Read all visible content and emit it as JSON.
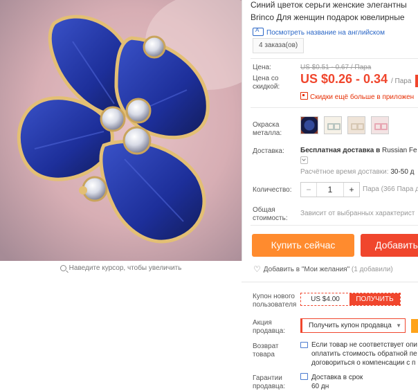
{
  "product": {
    "title_line1": "Синий цветок серьги женские элегантны",
    "title_line2": "Brinco Для женщин подарок ювелирные",
    "translate_link": "Посмотреть название на английском",
    "orders": "4 заказа(ов)"
  },
  "gallery": {
    "zoom_hint": "Наведите курсор, чтобы увеличить"
  },
  "price": {
    "label": "Цена:",
    "original": "US $0.51 - 0.67 / Пара",
    "discount_label": "Цена со скидкой:",
    "sale": "US $0.26 - 0.34",
    "sale_unit": "/ Пара",
    "app_discount": "Скидки ещё больше в приложен"
  },
  "color": {
    "label": "Окраска металла:",
    "swatches": [
      "swatch-blue-flower",
      "swatch-silver",
      "swatch-champagne",
      "swatch-pink"
    ]
  },
  "shipping": {
    "label": "Доставка:",
    "free_prefix": "Бесплатная доставка в",
    "free_dest": "Russian Fe",
    "time_label": "Расчётное время доставки:",
    "time_value": "30-50 д"
  },
  "quantity": {
    "label": "Количество:",
    "minus": "−",
    "value": "1",
    "plus": "+",
    "note": "Пара (366 Пара д"
  },
  "total": {
    "label": "Общая стоимость:",
    "note": "Зависит от выбранных характерист"
  },
  "actions": {
    "buy_now": "Купить сейчас",
    "add_to_cart": "Добавить",
    "wishlist": "Добавить в \"Мои желания\"",
    "wishlist_count": "(1 добавили)"
  },
  "coupon": {
    "label": "Купон нового пользователя",
    "amount": "US $4.00",
    "get": "ПОЛУЧИТЬ"
  },
  "promo": {
    "label": "Акция продавца:",
    "select_value": "Получить купон продавца"
  },
  "returns": {
    "label": "Возврат товара",
    "line1": "Если товар не соответствует опи",
    "line2": "оплатить стоимость обратной пе",
    "line3": "договориться о компенсации с п"
  },
  "guarantee": {
    "label": "Гарантии продавца:",
    "line1": "Доставка в срок",
    "line2": "60 дн"
  },
  "colors": {
    "accent_red": "#f0462d",
    "buy_orange": "#ff8b2e",
    "link_blue": "#2a66c6"
  }
}
